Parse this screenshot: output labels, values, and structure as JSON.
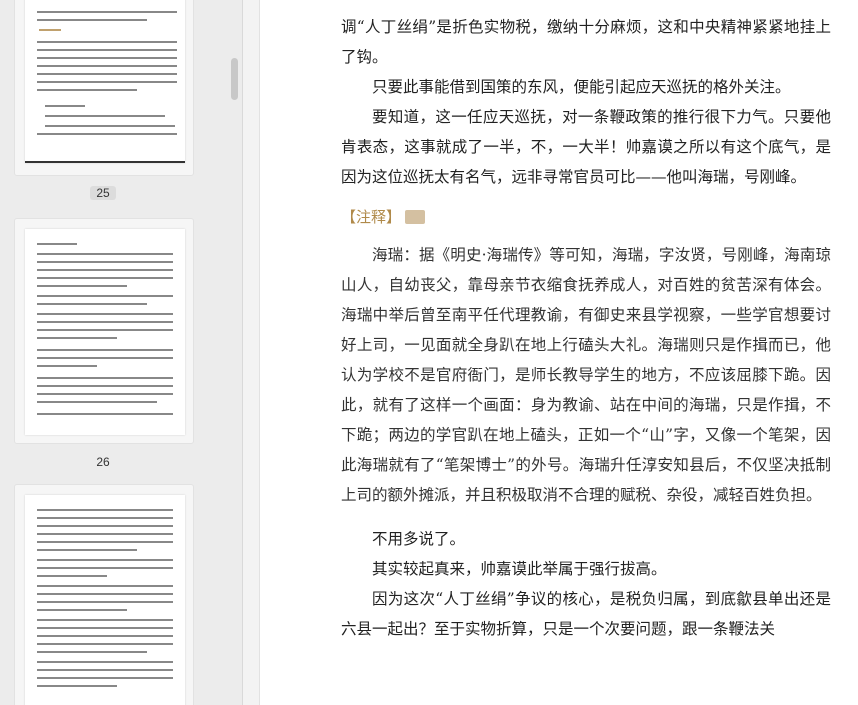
{
  "sidebar": {
    "thumbnails": [
      {
        "page_label": "25",
        "selected": true
      },
      {
        "page_label": "26",
        "selected": false
      },
      {
        "page_label": "",
        "selected": false
      }
    ]
  },
  "reader": {
    "paragraphs": [
      {
        "text": "调“人丁丝绢”是折色实物税，缴纳十分麻烦，这和中央精神紧紧地挂上了钩。",
        "indent": false
      },
      {
        "text": "只要此事能借到国策的东风，便能引起应天巡抚的格外关注。",
        "indent": true
      },
      {
        "text": "要知道，这一任应天巡抚，对一条鞭政策的推行很下力气。只要他肯表态，这事就成了一半，不，一大半！帅嘉谟之所以有这个底气，是因为这位巡抚太有名气，远非寻常官员可比——他叫海瑞，号刚峰。",
        "indent": true
      }
    ],
    "note_heading": "【注释】",
    "note_text": "海瑞：据《明史·海瑞传》等可知，海瑞，字汝贤，号刚峰，海南琼山人，自幼丧父，靠母亲节衣缩食抚养成人，对百姓的贫苦深有体会。海瑞中举后曾至南平任代理教谕，有御史来县学视察，一些学官想要讨好上司，一见面就全身趴在地上行磕头大礼。海瑞则只是作揖而已，他认为学校不是官府衙门，是师长教导学生的地方，不应该屈膝下跪。因此，就有了这样一个画面：身为教谕、站在中间的海瑞，只是作揖，不下跪；两边的学官趴在地上磕头，正如一个“山”字，又像一个笔架，因此海瑞就有了“笔架博士”的外号。海瑞升任淳安知县后，不仅坚决抵制上司的额外摊派，并且积极取消不合理的赋税、杂役，减轻百姓负担。",
    "after": [
      {
        "text": "不用多说了。",
        "indent": true
      },
      {
        "text": "其实较起真来，帅嘉谟此举属于强行拔高。",
        "indent": true
      },
      {
        "text": "因为这次“人丁丝绢”争议的核心，是税负归属，到底歙县单出还是六县一起出？至于实物折算，只是一个次要问题，跟一条鞭法关",
        "indent": true
      }
    ]
  }
}
